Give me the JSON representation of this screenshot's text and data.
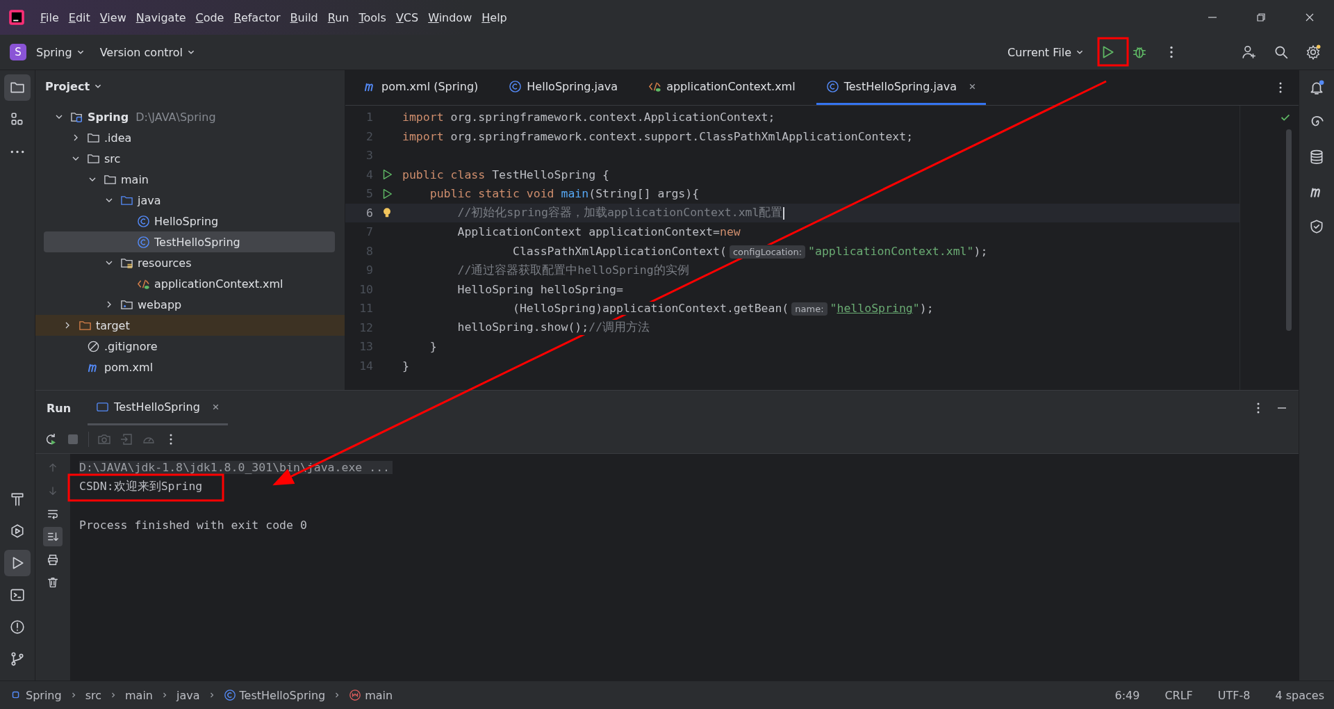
{
  "menu": [
    {
      "label": "File"
    },
    {
      "label": "Edit"
    },
    {
      "label": "View"
    },
    {
      "label": "Navigate"
    },
    {
      "label": "Code"
    },
    {
      "label": "Refactor"
    },
    {
      "label": "Build"
    },
    {
      "label": "Run"
    },
    {
      "label": "Tools"
    },
    {
      "label": "VCS"
    },
    {
      "label": "Window"
    },
    {
      "label": "Help"
    }
  ],
  "toolbar": {
    "project_badge": "S",
    "project": "Spring",
    "vcs": "Version control",
    "run_config": "Current File"
  },
  "left_tools_top": [
    {
      "kind": "folder",
      "selected": true
    },
    {
      "kind": "structure",
      "selected": false
    },
    {
      "kind": "more",
      "selected": false
    }
  ],
  "left_tools_bottom": [
    {
      "kind": "hammer",
      "selected": false
    },
    {
      "kind": "services",
      "selected": false
    },
    {
      "kind": "run",
      "selected": true
    },
    {
      "kind": "terminal",
      "selected": false
    },
    {
      "kind": "problems",
      "selected": false
    },
    {
      "kind": "git",
      "selected": false
    }
  ],
  "right_tools": [
    {
      "kind": "bell",
      "badge": true
    },
    {
      "kind": "spiral"
    },
    {
      "kind": "database"
    },
    {
      "kind": "maven"
    },
    {
      "kind": "shield"
    }
  ],
  "project": {
    "title": "Project",
    "tree": [
      {
        "label": "Spring",
        "path": "D:\\JAVA\\Spring",
        "kind": "project",
        "expanded": true,
        "selected": false,
        "children": [
          {
            "label": ".idea",
            "kind": "folder",
            "expanded": false,
            "selected": false
          },
          {
            "label": "src",
            "kind": "folder",
            "expanded": true,
            "selected": false,
            "children": [
              {
                "label": "main",
                "kind": "folder",
                "expanded": true,
                "selected": false,
                "children": [
                  {
                    "label": "java",
                    "kind": "folder-src",
                    "expanded": true,
                    "selected": false,
                    "children": [
                      {
                        "label": "HelloSpring",
                        "kind": "class",
                        "selected": false
                      },
                      {
                        "label": "TestHelloSpring",
                        "kind": "class",
                        "selected": true
                      }
                    ]
                  },
                  {
                    "label": "resources",
                    "kind": "resources",
                    "expanded": true,
                    "selected": false,
                    "children": [
                      {
                        "label": "applicationContext.xml",
                        "kind": "xml",
                        "selected": false
                      }
                    ]
                  },
                  {
                    "label": "webapp",
                    "kind": "webapp",
                    "expanded": false,
                    "selected": false
                  }
                ]
              }
            ]
          },
          {
            "label": "target",
            "kind": "folder-excluded",
            "expanded": false,
            "selected": false
          },
          {
            "label": ".gitignore",
            "kind": "ignore",
            "selected": false
          },
          {
            "label": "pom.xml",
            "kind": "maven",
            "selected": false
          }
        ]
      }
    ]
  },
  "editor_tabs": [
    {
      "label": "pom.xml (Spring)",
      "kind": "maven",
      "selected": false
    },
    {
      "label": "HelloSpring.java",
      "kind": "class",
      "selected": false
    },
    {
      "label": "applicationContext.xml",
      "kind": "xml",
      "selected": false
    },
    {
      "label": "TestHelloSpring.java",
      "kind": "class",
      "selected": true
    }
  ],
  "code": [
    {
      "num": "1",
      "current": false,
      "tokens": [
        {
          "kind": "keyword",
          "s": "import "
        },
        {
          "kind": "plain",
          "s": "org.springframework.context.ApplicationContext;"
        }
      ]
    },
    {
      "num": "2",
      "current": false,
      "tokens": [
        {
          "kind": "keyword",
          "s": "import "
        },
        {
          "kind": "plain",
          "s": "org.springframework.context.support.ClassPathXmlApplicationContext;"
        }
      ]
    },
    {
      "num": "3",
      "current": false
    },
    {
      "num": "4",
      "current": false,
      "gutter": {
        "kind": "run"
      },
      "tokens": [
        {
          "kind": "keyword",
          "s": "public class "
        },
        {
          "kind": "plain",
          "s": "TestHelloSpring {"
        }
      ]
    },
    {
      "num": "5",
      "current": false,
      "gutter": {
        "kind": "run"
      },
      "tokens": [
        {
          "kind": "keyword",
          "s": "    public static void "
        },
        {
          "kind": "function",
          "s": "main"
        },
        {
          "kind": "plain",
          "s": "(String[] args){"
        }
      ]
    },
    {
      "num": "6",
      "current": true,
      "gutter": {
        "kind": "bulb"
      },
      "tokens": [
        {
          "kind": "comment",
          "s": "        //初始化spring容器，加载applicationContext.xml配置"
        }
      ]
    },
    {
      "num": "7",
      "current": false,
      "tokens": [
        {
          "kind": "plain",
          "s": "        ApplicationContext applicationContext="
        },
        {
          "kind": "keyword",
          "s": "new"
        }
      ]
    },
    {
      "num": "8",
      "current": false,
      "tokens": [
        {
          "kind": "plain",
          "s": "                ClassPathXmlApplicationContext("
        },
        {
          "kind": "hint",
          "s": "configLocation:"
        },
        {
          "kind": "string",
          "s": "\"applicationContext.xml\""
        },
        {
          "kind": "plain",
          "s": ");"
        }
      ]
    },
    {
      "num": "9",
      "current": false,
      "tokens": [
        {
          "kind": "comment",
          "s": "        //通过容器获取配置中helloSpring的实例"
        }
      ]
    },
    {
      "num": "10",
      "current": false,
      "tokens": [
        {
          "kind": "plain",
          "s": "        HelloSpring helloSpring="
        }
      ]
    },
    {
      "num": "11",
      "current": false,
      "tokens": [
        {
          "kind": "plain",
          "s": "                (HelloSpring)applicationContext.getBean("
        },
        {
          "kind": "hint",
          "s": "name:"
        },
        {
          "kind": "string",
          "s": "\""
        },
        {
          "kind": "link",
          "s": "helloSpring"
        },
        {
          "kind": "string",
          "s": "\""
        },
        {
          "kind": "plain",
          "s": ");"
        }
      ]
    },
    {
      "num": "12",
      "current": false,
      "tokens": [
        {
          "kind": "plain",
          "s": "        helloSpring.show();"
        },
        {
          "kind": "comment",
          "s": "//调用方法"
        }
      ]
    },
    {
      "num": "13",
      "current": false,
      "tokens": [
        {
          "kind": "plain",
          "s": "    }"
        }
      ]
    },
    {
      "num": "14",
      "current": false,
      "tokens": [
        {
          "kind": "plain",
          "s": "}"
        }
      ]
    }
  ],
  "run_panel": {
    "title": "Run",
    "tab": "TestHelloSpring",
    "console": [
      {
        "kind": "command",
        "text": "D:\\JAVA\\jdk-1.8\\jdk1.8.0_301\\bin\\java.exe ..."
      },
      {
        "kind": "output",
        "text": "CSDN:欢迎来到Spring"
      },
      {
        "kind": "exit",
        "text": "Process finished with exit code 0"
      }
    ],
    "side_tools": [
      {
        "kind": "up",
        "selected": false
      },
      {
        "kind": "down",
        "selected": false
      },
      {
        "kind": "wrap",
        "selected": false
      },
      {
        "kind": "scroll-end",
        "selected": true
      },
      {
        "kind": "print",
        "selected": false
      },
      {
        "kind": "trash",
        "selected": false
      }
    ]
  },
  "breadcrumbs": [
    {
      "label": "Spring",
      "kind": "module"
    },
    {
      "label": "src",
      "kind": "none"
    },
    {
      "label": "main",
      "kind": "none"
    },
    {
      "label": "java",
      "kind": "none"
    },
    {
      "label": "TestHelloSpring",
      "kind": "class"
    },
    {
      "label": "main",
      "kind": "method"
    }
  ],
  "status": [
    "6:49",
    "CRLF",
    "UTF-8",
    "4 spaces"
  ]
}
